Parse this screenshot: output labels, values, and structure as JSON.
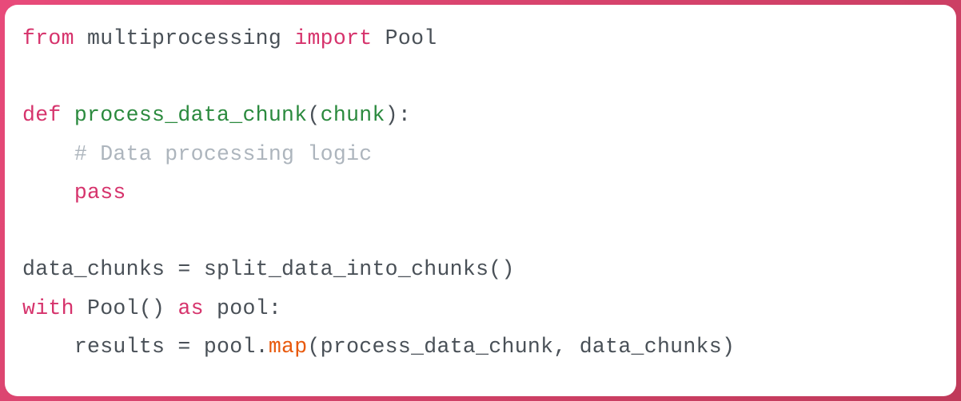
{
  "code": {
    "line1": {
      "kw_from": "from",
      "module": " multiprocessing ",
      "kw_import": "import",
      "name": " Pool"
    },
    "line2": "",
    "line3": {
      "kw_def": "def",
      "sp": " ",
      "fn": "process_data_chunk",
      "open": "(",
      "param": "chunk",
      "close": "):"
    },
    "line4": {
      "indent": "    ",
      "comment": "# Data processing logic"
    },
    "line5": {
      "indent": "    ",
      "kw_pass": "pass"
    },
    "line6": "",
    "line7": {
      "text": "data_chunks = split_data_into_chunks()"
    },
    "line8": {
      "kw_with": "with",
      "mid": " Pool() ",
      "kw_as": "as",
      "tail": " pool:"
    },
    "line9": {
      "indent": "    ",
      "pre": "results = pool.",
      "method": "map",
      "post": "(process_data_chunk, data_chunks)"
    }
  }
}
